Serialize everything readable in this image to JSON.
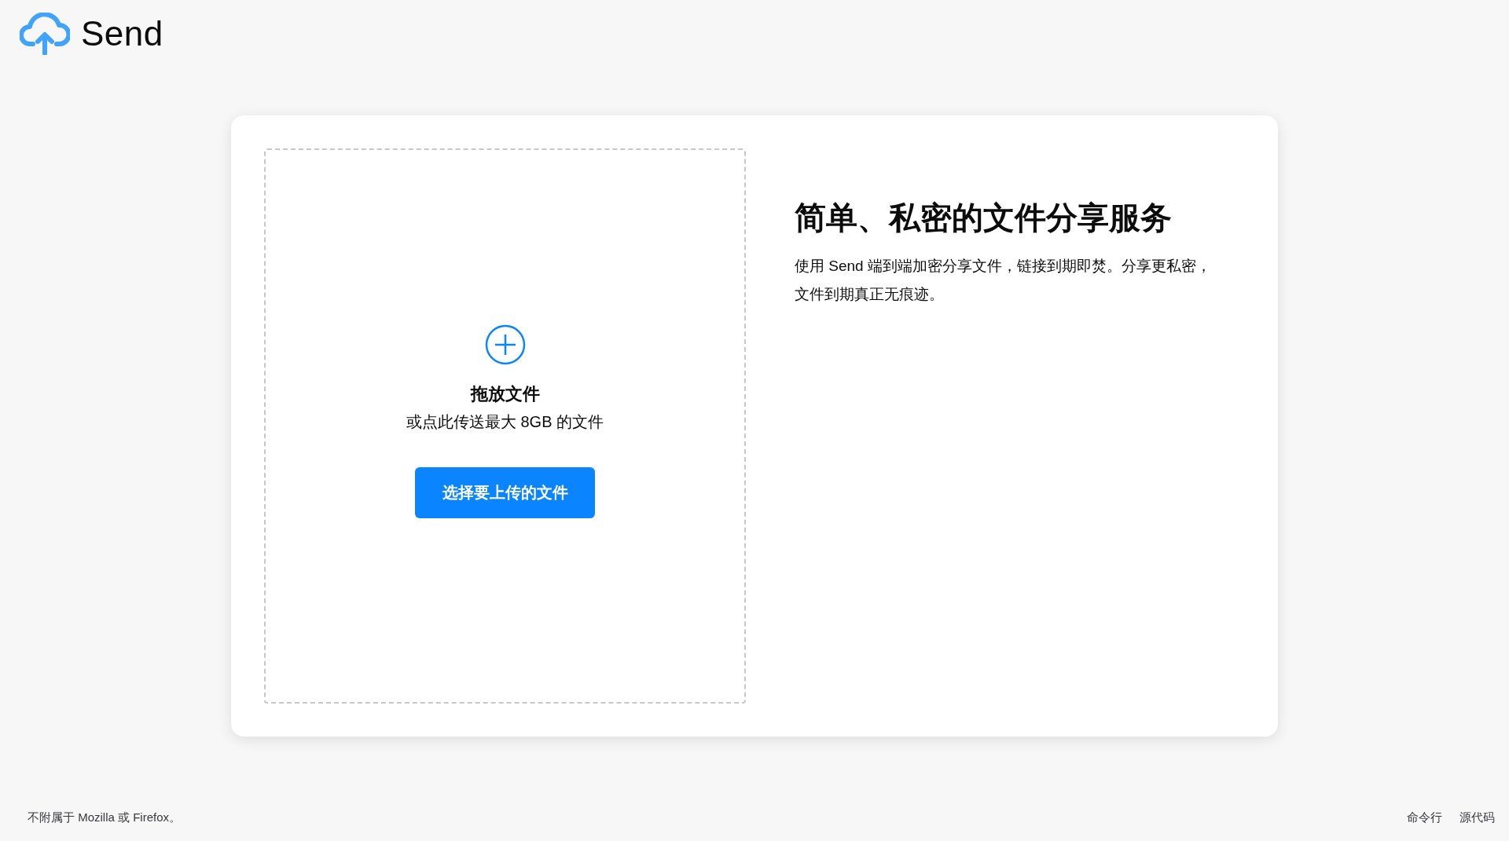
{
  "header": {
    "logo_text": "Send"
  },
  "upload": {
    "title": "拖放文件",
    "subtitle": "或点此传送最大 8GB 的文件",
    "button": "选择要上传的文件"
  },
  "intro": {
    "title": "简单、私密的文件分享服务",
    "description": "使用 Send 端到端加密分享文件，链接到期即焚。分享更私密，文件到期真正无痕迹。"
  },
  "footer": {
    "notice": "不附属于 Mozilla 或 Firefox。",
    "links": [
      "命令行",
      "源代码"
    ]
  }
}
